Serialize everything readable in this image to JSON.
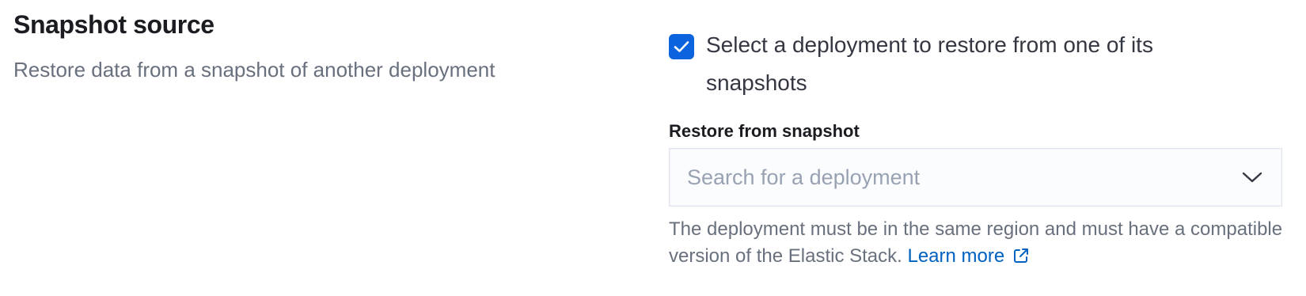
{
  "section": {
    "title": "Snapshot source",
    "description": "Restore data from a snapshot of another deployment"
  },
  "restore_checkbox": {
    "checked": true,
    "label": "Select a deployment to restore from one of its snapshots"
  },
  "restore_field": {
    "label": "Restore from snapshot",
    "value": "",
    "placeholder": "Search for a deployment",
    "icon": "chevron-down-icon"
  },
  "help": {
    "text": "The deployment must be in the same region and must have a compatible version of the Elastic Stack.",
    "link_label": "Learn more",
    "link_icon": "external-link-icon"
  },
  "colors": {
    "accent": "#0b64dd",
    "link": "#0061c2",
    "muted_text": "#69707d",
    "title_text": "#1a1c21"
  }
}
